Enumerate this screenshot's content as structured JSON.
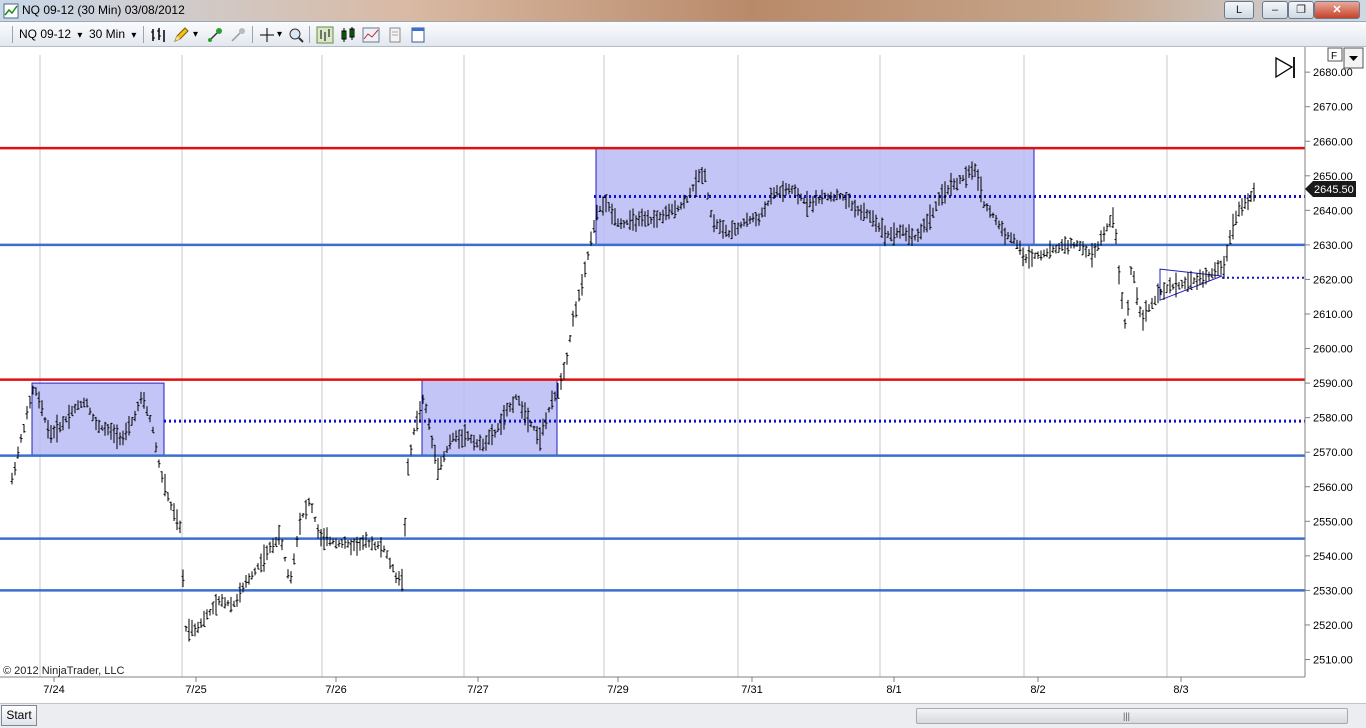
{
  "window": {
    "title": "NQ 09-12 (30 Min)  03/08/2012",
    "link_label": "L",
    "min_label": "–",
    "max_label": "❐",
    "close_label": "✕"
  },
  "toolbar": {
    "instrument": "NQ 09-12",
    "interval": "30 Min",
    "dropdown_arrow": "▾"
  },
  "chart": {
    "copyright": "© 2012 NinjaTrader, LLC",
    "current_price_label": "2645.50",
    "panel_button": "F",
    "y_ticks": [
      "2510.00",
      "2520.00",
      "2530.00",
      "2540.00",
      "2550.00",
      "2560.00",
      "2570.00",
      "2580.00",
      "2590.00",
      "2600.00",
      "2610.00",
      "2620.00",
      "2630.00",
      "2640.00",
      "2650.00",
      "2660.00",
      "2670.00",
      "2680.00"
    ],
    "x_labels": [
      "7/24",
      "7/25",
      "7/26",
      "7/27",
      "7/29",
      "7/31",
      "8/1",
      "8/2",
      "8/3"
    ],
    "colors": {
      "resistance_line": "#e01010",
      "support_line": "#3a6fd0",
      "dotted_line": "#1010d0",
      "range_box_fill": "#b8bbf4",
      "range_box_border": "#2020c0",
      "price_bar": "#000000",
      "price_marker": "#1a1a1a"
    }
  },
  "statusbar": {
    "start_tab": "Start",
    "scroll_grip": "|||"
  }
}
